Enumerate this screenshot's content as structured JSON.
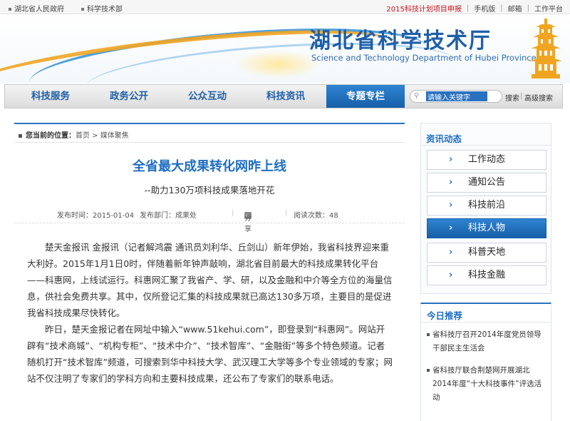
{
  "topbar": {
    "left_links": [
      "湖北省人民政府",
      "科学技术部"
    ],
    "right_links": [
      "2015科技计划项目申报",
      "手机版",
      "邮箱",
      "工作平台"
    ],
    "separator": "|"
  },
  "banner": {
    "title_cn": "湖北省科学技术厅",
    "title_en": "Science and Technology Department of Hubei Province"
  },
  "nav": {
    "items": [
      "科技服务",
      "政务公开",
      "公众互动",
      "科技资讯",
      "专题专栏"
    ],
    "active": "专题专栏",
    "search_placeholder": "请输入关键字",
    "search_button": "搜索",
    "advanced_search": "高级搜索",
    "separator": "|"
  },
  "breadcrumb": {
    "label": "您当前的位置：",
    "path": "首页 > 媒体聚焦"
  },
  "article": {
    "title": "全省最大成果转化网昨上线",
    "subtitle": "--助力130万项科技成果落地开花",
    "meta": {
      "publish_time": "发布时间：2015-01-04",
      "department": "发布部门：成果处",
      "share": "分享",
      "views": "阅读次数：48"
    },
    "paragraphs": [
      "楚天金报讯 金报讯（记者解鸿震 通讯员刘利华、丘剑山）新年伊始，我省科技界迎来重大利好。2015年1月1日0时，伴随着新年钟声敲响，湖北省目前最大的科技成果转化平台——科惠网，上线试运行。科惠网汇聚了我省产、学、研，以及金融和中介等全方位的海量信息，供社会免费共享。其中，仅所登记汇集的科技成果就已高达130多万项，主要目的是促进我省科技成果尽快转化。",
      "昨日，楚天金报记者在网址中输入“www.51kehui.com”，即登录到“科惠网”。网站开辟有“技术商城”、“机构专柜”、“技术中介”、“技术智库”、“金融街”等多个特色频道。记者随机打开“技术智库”频道，可搜索到华中科技大学、武汉理工大学等多个专业领域的专家；网站不仅注明了专家们的学科方向和主要科技成果，还公布了专家们的联系电话。"
    ]
  },
  "sidebar": {
    "news_title": "资讯动态",
    "menu": [
      "工作动态",
      "通知公告",
      "科技前沿",
      "科技人物",
      "科普天地",
      "科技金融"
    ],
    "active_menu": "科技人物",
    "recommend_title": "今日推荐",
    "recommend": [
      "省科技厅召开2014年度党员领导干部民主生活会",
      "省科技厅联合荆楚网开展湖北2014年度“十大科技事件”评选活动"
    ]
  },
  "colors": {
    "brand_blue": "#1f6ec4",
    "active_blue": "#1f6fc0",
    "red_link": "#c8161d"
  }
}
